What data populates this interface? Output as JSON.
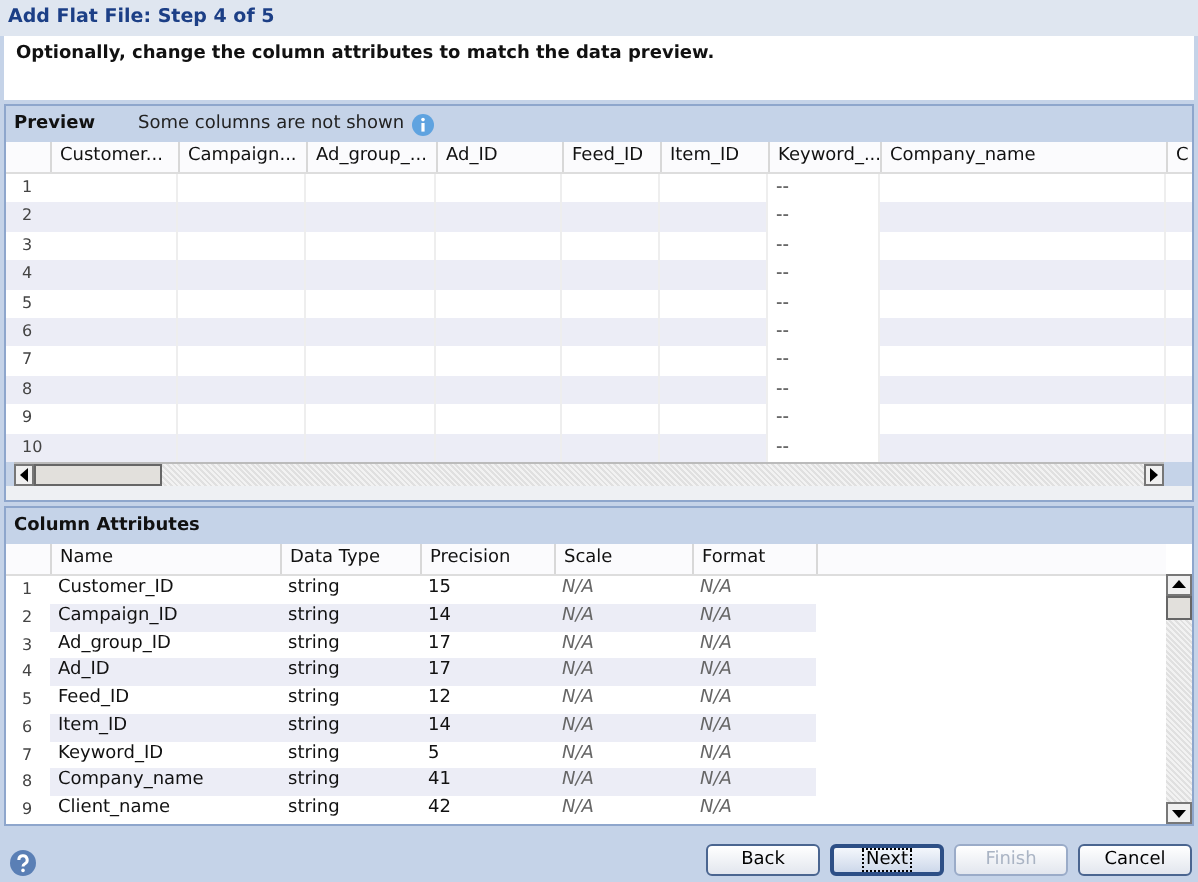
{
  "window": {
    "title": "Add Flat File: Step 4 of 5"
  },
  "instruction": "Optionally, change the column attributes to match the data preview.",
  "preview": {
    "title": "Preview",
    "note": "Some columns are not shown",
    "columns": [
      "Customer...",
      "Campaign...",
      "Ad_group_...",
      "Ad_ID",
      "Feed_ID",
      "Item_ID",
      "Keyword_...",
      "Company_name",
      "C"
    ],
    "rows": [
      {
        "number": "1",
        "keyword": "--"
      },
      {
        "number": "2",
        "keyword": "--"
      },
      {
        "number": "3",
        "keyword": "--"
      },
      {
        "number": "4",
        "keyword": "--"
      },
      {
        "number": "5",
        "keyword": "--"
      },
      {
        "number": "6",
        "keyword": "--"
      },
      {
        "number": "7",
        "keyword": "--"
      },
      {
        "number": "8",
        "keyword": "--"
      },
      {
        "number": "9",
        "keyword": "--"
      },
      {
        "number": "10",
        "keyword": "--"
      }
    ]
  },
  "column_attributes": {
    "title": "Column Attributes",
    "columns": [
      "Name",
      "Data Type",
      "Precision",
      "Scale",
      "Format"
    ],
    "rows": [
      {
        "number": "1",
        "name": "Customer_ID",
        "data_type": "string",
        "precision": "15",
        "scale": "N/A",
        "format": "N/A"
      },
      {
        "number": "2",
        "name": "Campaign_ID",
        "data_type": "string",
        "precision": "14",
        "scale": "N/A",
        "format": "N/A"
      },
      {
        "number": "3",
        "name": "Ad_group_ID",
        "data_type": "string",
        "precision": "17",
        "scale": "N/A",
        "format": "N/A"
      },
      {
        "number": "4",
        "name": "Ad_ID",
        "data_type": "string",
        "precision": "17",
        "scale": "N/A",
        "format": "N/A"
      },
      {
        "number": "5",
        "name": "Feed_ID",
        "data_type": "string",
        "precision": "12",
        "scale": "N/A",
        "format": "N/A"
      },
      {
        "number": "6",
        "name": "Item_ID",
        "data_type": "string",
        "precision": "14",
        "scale": "N/A",
        "format": "N/A"
      },
      {
        "number": "7",
        "name": "Keyword_ID",
        "data_type": "string",
        "precision": "5",
        "scale": "N/A",
        "format": "N/A"
      },
      {
        "number": "8",
        "name": "Company_name",
        "data_type": "string",
        "precision": "41",
        "scale": "N/A",
        "format": "N/A"
      },
      {
        "number": "9",
        "name": "Client_name",
        "data_type": "string",
        "precision": "42",
        "scale": "N/A",
        "format": "N/A"
      }
    ]
  },
  "buttons": [
    {
      "label": "Back",
      "disabled": false,
      "focused": false
    },
    {
      "label": "Next",
      "disabled": false,
      "focused": true
    },
    {
      "label": "Finish",
      "disabled": true,
      "focused": false
    },
    {
      "label": "Cancel",
      "disabled": false,
      "focused": false
    }
  ]
}
